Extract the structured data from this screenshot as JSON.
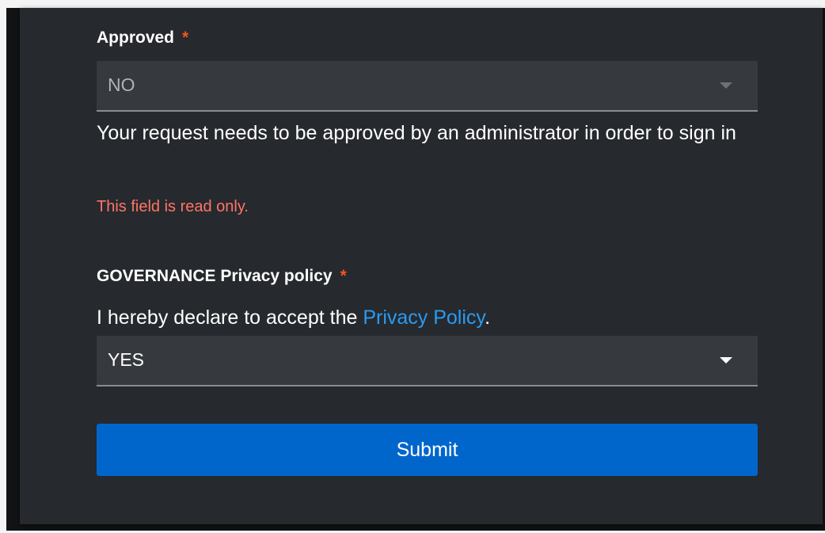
{
  "approved": {
    "label": "Approved",
    "required_mark": "*",
    "value": "NO",
    "help_text": "Your request needs to be approved by an administrator in order to sign in",
    "error_text": "This field is read only."
  },
  "privacy": {
    "label": "GOVERNANCE Privacy policy",
    "required_mark": "*",
    "declare_prefix": "I hereby declare to accept the ",
    "declare_link": "Privacy Policy",
    "declare_suffix": ".",
    "value": "YES"
  },
  "submit": {
    "label": "Submit"
  },
  "colors": {
    "panel": "#26292d",
    "field": "#36393d",
    "required": "#f0561d",
    "error": "#ff7468",
    "link": "#2b9af3",
    "primary": "#0066cc"
  }
}
